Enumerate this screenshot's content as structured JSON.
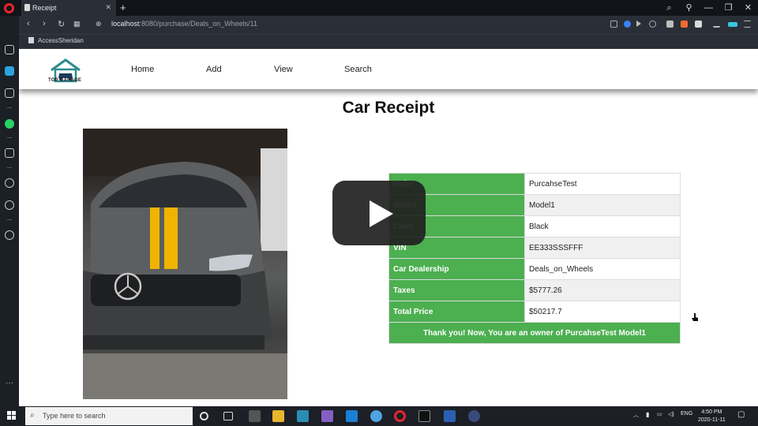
{
  "browser": {
    "tab_title": "Receipt",
    "new_tab": "+",
    "url_host": "localhost",
    "url_rest": ":8080/purchase/Deals_on_Wheels/11",
    "bookmark": "AccessSheridan"
  },
  "site": {
    "logo_text": "TOP GARAGE",
    "nav": [
      "Home",
      "Add",
      "View",
      "Search"
    ]
  },
  "page_title": "Car Receipt",
  "receipt": {
    "rows": [
      {
        "label": "Make",
        "value": "PurcahseTest"
      },
      {
        "label": "Model",
        "value": "Model1"
      },
      {
        "label": "Color",
        "value": "Black"
      },
      {
        "label": "VIN",
        "value": "EE333SSSFFF"
      },
      {
        "label": "Car Dealership",
        "value": "Deals_on_Wheels"
      },
      {
        "label": "Taxes",
        "value": "$5777.26"
      },
      {
        "label": "Total Price",
        "value": "$50217.7"
      }
    ],
    "thanks": "Thank you! Now, You are an owner of PurcahseTest Model1"
  },
  "taskbar": {
    "search_placeholder": "Type here to search",
    "lang": "ENG",
    "time": "4:50 PM",
    "date": "2020-11-11"
  },
  "colors": {
    "accent_green": "#4caf50",
    "opera_red": "#e6262e",
    "stripe_yellow": "#f0b400"
  }
}
